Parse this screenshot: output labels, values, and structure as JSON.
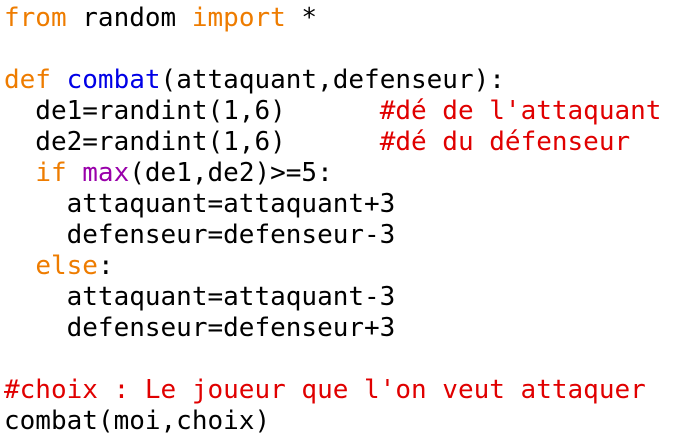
{
  "editor": {
    "lines": [
      [
        {
          "t": "from",
          "c": "kw"
        },
        {
          "t": " random ",
          "c": "tx"
        },
        {
          "t": "import",
          "c": "kw"
        },
        {
          "t": " *",
          "c": "tx"
        }
      ],
      [],
      [
        {
          "t": "def",
          "c": "kw"
        },
        {
          "t": " ",
          "c": "tx"
        },
        {
          "t": "combat",
          "c": "fn"
        },
        {
          "t": "(attaquant,defenseur):",
          "c": "tx"
        }
      ],
      [
        {
          "t": "  de1=randint(1,6)      ",
          "c": "tx"
        },
        {
          "t": "#dé de l'attaquant",
          "c": "cm"
        }
      ],
      [
        {
          "t": "  de2=randint(1,6)      ",
          "c": "tx"
        },
        {
          "t": "#dé du défenseur",
          "c": "cm"
        }
      ],
      [
        {
          "t": "  ",
          "c": "tx"
        },
        {
          "t": "if",
          "c": "kw"
        },
        {
          "t": " ",
          "c": "tx"
        },
        {
          "t": "max",
          "c": "bi"
        },
        {
          "t": "(de1,de2)>=5:",
          "c": "tx"
        }
      ],
      [
        {
          "t": "    attaquant=attaquant+3",
          "c": "tx"
        }
      ],
      [
        {
          "t": "    defenseur=defenseur-3",
          "c": "tx"
        }
      ],
      [
        {
          "t": "  ",
          "c": "tx"
        },
        {
          "t": "else",
          "c": "kw"
        },
        {
          "t": ":",
          "c": "tx"
        }
      ],
      [
        {
          "t": "    attaquant=attaquant-3",
          "c": "tx"
        }
      ],
      [
        {
          "t": "    defenseur=defenseur+3",
          "c": "tx"
        }
      ],
      [],
      [
        {
          "t": "#choix : Le joueur que l'on veut attaquer",
          "c": "cm"
        }
      ],
      [
        {
          "t": "combat(moi,choix)",
          "c": "tx"
        }
      ]
    ]
  },
  "colors": {
    "keyword": "#ee7c00",
    "function_name": "#0000e6",
    "builtin": "#9900aa",
    "comment": "#e00000",
    "text": "#000000",
    "background": "#ffffff"
  }
}
